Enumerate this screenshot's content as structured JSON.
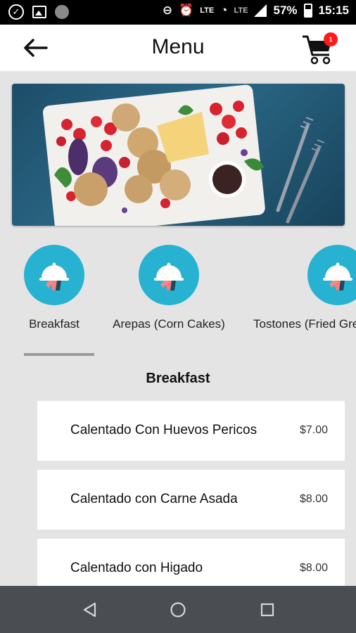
{
  "status_bar": {
    "network_type": "LTE",
    "secondary_network": "LTE",
    "battery_percent": "57%",
    "time": "15:15"
  },
  "app_bar": {
    "title": "Menu",
    "cart_count": "1",
    "icons": {
      "back": "arrow-left-icon",
      "cart": "shopping-cart-icon"
    }
  },
  "categories": [
    {
      "label": "Breakfast",
      "icon": "food-cloche-icon"
    },
    {
      "label": "Arepas (Corn Cakes)",
      "icon": "food-cloche-icon"
    },
    {
      "label": "Tostones (Fried Gre",
      "icon": "food-cloche-icon"
    }
  ],
  "selected_category_index": 0,
  "section": {
    "title": "Breakfast"
  },
  "items": [
    {
      "name": "Calentado Con Huevos Pericos",
      "price": "$7.00"
    },
    {
      "name": "Calentado con Carne Asada",
      "price": "$8.00"
    },
    {
      "name": "Calentado con Higado",
      "price": "$8.00"
    }
  ],
  "colors": {
    "accent": "#27b2d1",
    "badge": "#ff1a1a",
    "background": "#e4e4e4",
    "nav_bar": "#4a4d51"
  }
}
